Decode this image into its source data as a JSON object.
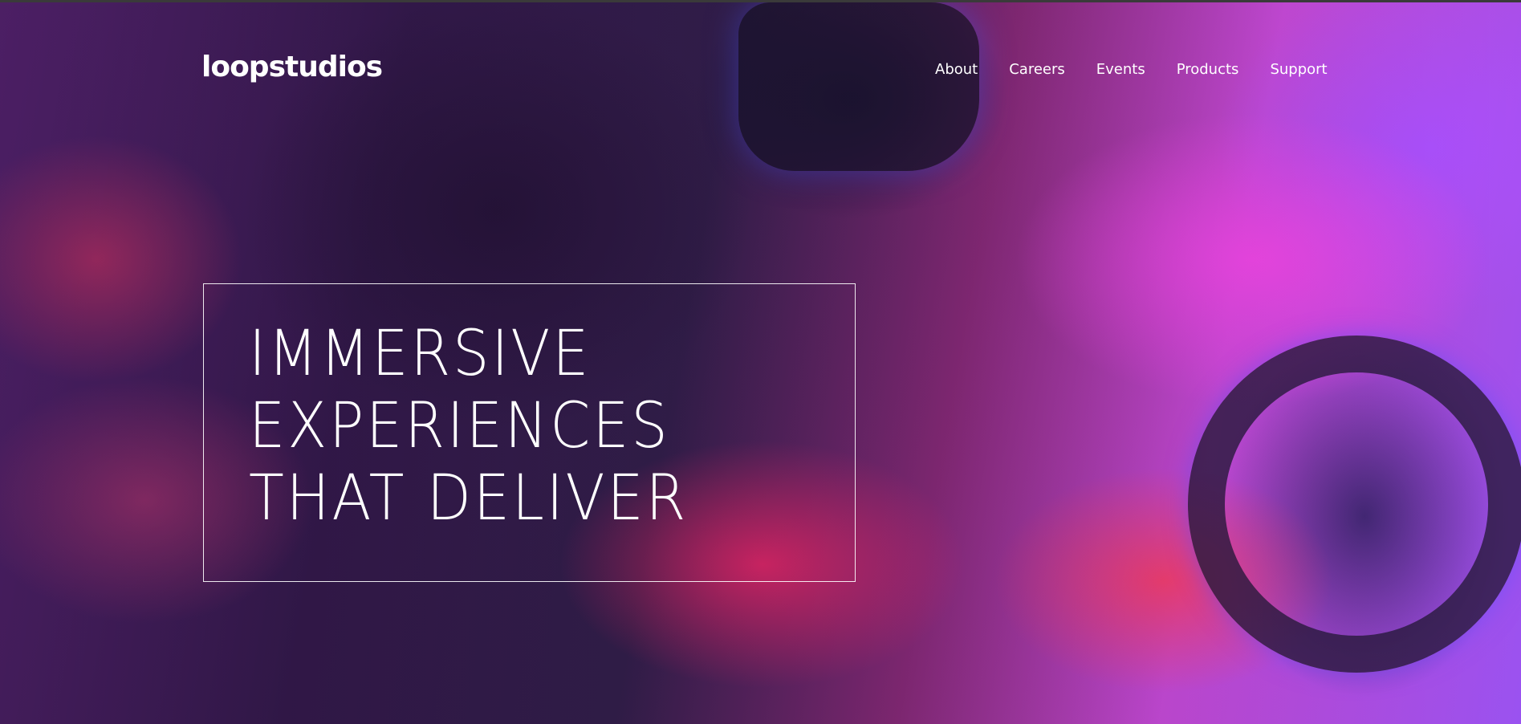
{
  "header": {
    "logo": "loopstudios",
    "nav": [
      {
        "label": "About"
      },
      {
        "label": "Careers"
      },
      {
        "label": "Events"
      },
      {
        "label": "Products"
      },
      {
        "label": "Support"
      }
    ]
  },
  "hero": {
    "headline_lines": [
      "IMMERSIVE",
      "EXPERIENCES",
      "THAT DELIVER"
    ],
    "image_icon": "vr-racing-photo"
  },
  "colors": {
    "text": "#ffffff",
    "accent_magenta": "#e040d0",
    "accent_purple": "#9a52f0",
    "accent_red": "#ff2a6e"
  }
}
